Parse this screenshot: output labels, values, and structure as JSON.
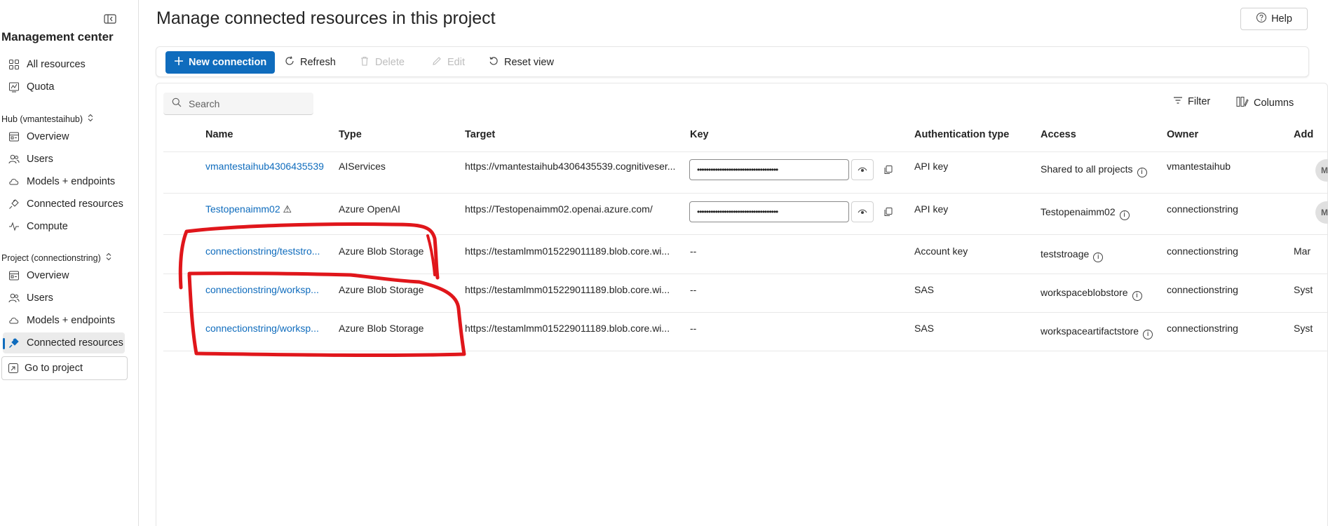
{
  "sidebar": {
    "title": "Management center",
    "top_items": [
      {
        "label": "All resources",
        "icon": "grid-icon"
      },
      {
        "label": "Quota",
        "icon": "gauge-icon"
      }
    ],
    "hub_section": "Hub (vmantestaihub)",
    "hub_items": [
      {
        "label": "Overview",
        "icon": "overview-icon"
      },
      {
        "label": "Users",
        "icon": "users-icon"
      },
      {
        "label": "Models + endpoints",
        "icon": "cloud-icon"
      },
      {
        "label": "Connected resources",
        "icon": "plug-icon"
      },
      {
        "label": "Compute",
        "icon": "pulse-icon"
      }
    ],
    "project_section": "Project (connectionstring)",
    "project_items": [
      {
        "label": "Overview",
        "icon": "overview-icon"
      },
      {
        "label": "Users",
        "icon": "users-icon"
      },
      {
        "label": "Models + endpoints",
        "icon": "cloud-icon"
      },
      {
        "label": "Connected resources",
        "icon": "plug-icon"
      }
    ],
    "go_to_project": "Go to project"
  },
  "header": {
    "title": "Manage connected resources in this project",
    "help": "Help"
  },
  "toolbar": {
    "new_connection": "New connection",
    "refresh": "Refresh",
    "delete": "Delete",
    "edit": "Edit",
    "reset_view": "Reset view"
  },
  "search": {
    "placeholder": "Search"
  },
  "filter": "Filter",
  "columns_btn": "Columns",
  "table": {
    "headers": [
      "Name",
      "Type",
      "Target",
      "Key",
      "Authentication type",
      "Access",
      "Owner",
      "Add"
    ],
    "rows": [
      {
        "name": "vmantestaihub4306435539",
        "warn": "",
        "type": "AIServices",
        "target": "https://vmantestaihub4306435539.cognitiveser...",
        "key": "••••••••••••••••••••••••••••••••••••",
        "auth": "API key",
        "access": "Shared to all projects",
        "owner": "vmantestaihub",
        "added": "MM"
      },
      {
        "name": "Testopenaimm02",
        "warn": "⚠",
        "type": "Azure OpenAI",
        "target": "https://Testopenaimm02.openai.azure.com/",
        "key": "••••••••••••••••••••••••••••••••••••",
        "auth": "API key",
        "access": "Testopenaimm02",
        "owner": "connectionstring",
        "added": "MM"
      },
      {
        "name": "connectionstring/teststro...",
        "warn": "",
        "type": "Azure Blob Storage",
        "target": "https://testamlmm015229011189.blob.core.wi...",
        "key": "--",
        "auth": "Account key",
        "access": "teststroage",
        "owner": "connectionstring",
        "added": "Mar"
      },
      {
        "name": "connectionstring/worksp...",
        "warn": "",
        "type": "Azure Blob Storage",
        "target": "https://testamlmm015229011189.blob.core.wi...",
        "key": "--",
        "auth": "SAS",
        "access": "workspaceblobstore",
        "owner": "connectionstring",
        "added": "Syst"
      },
      {
        "name": "connectionstring/worksp...",
        "warn": "",
        "type": "Azure Blob Storage",
        "target": "https://testamlmm015229011189.blob.core.wi...",
        "key": "--",
        "auth": "SAS",
        "access": "workspaceartifactstore",
        "owner": "connectionstring",
        "added": "Syst"
      }
    ]
  },
  "colors": {
    "accent": "#0f6cbd",
    "annotation": "#e0161b"
  }
}
